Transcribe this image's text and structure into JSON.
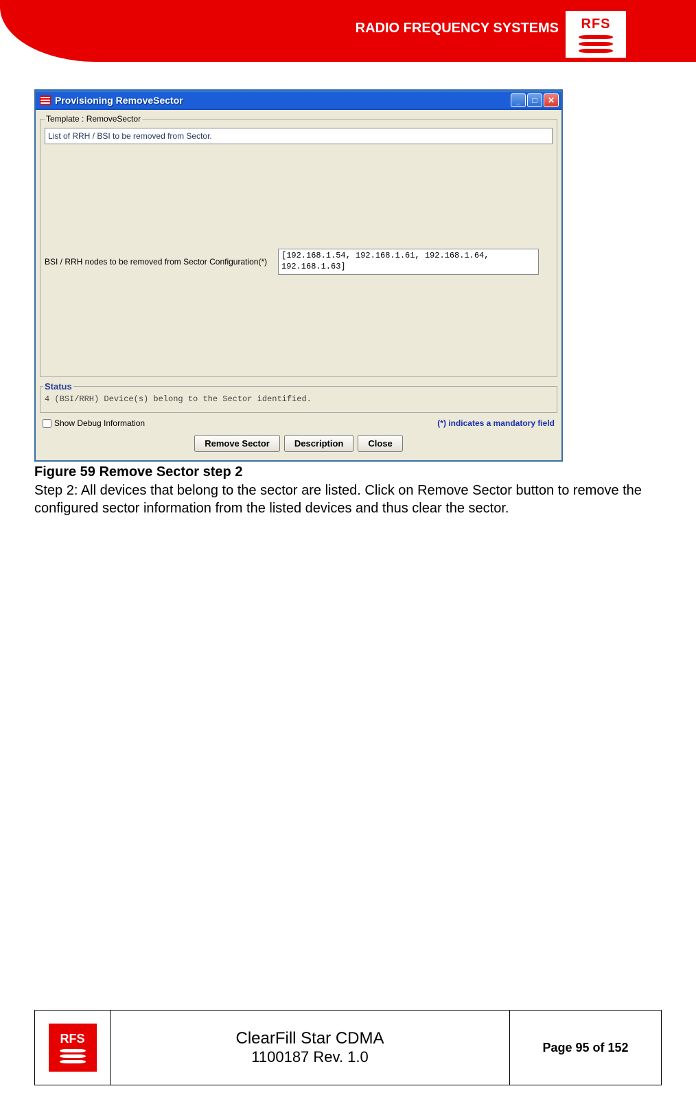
{
  "header": {
    "company": "RADIO FREQUENCY SYSTEMS",
    "logo_text": "RFS"
  },
  "window": {
    "title": "Provisioning RemoveSector",
    "template_legend": "Template : RemoveSector",
    "list_label": "List of RRH / BSI to be removed from Sector.",
    "nodes_label": "BSI / RRH nodes to be removed from Sector Configuration(*)",
    "ip_list": "[192.168.1.54, 192.168.1.61, 192.168.1.64, 192.168.1.63]",
    "status_legend": "Status",
    "status_text": "4 (BSI/RRH) Device(s) belong to the Sector identified.",
    "debug_label": "Show Debug Information",
    "mandatory": "(*) indicates a mandatory field",
    "buttons": {
      "remove": "Remove Sector",
      "description": "Description",
      "close": "Close"
    },
    "controls": {
      "minimize": "_",
      "maximize": "□",
      "close": "✕"
    }
  },
  "figure": {
    "caption": "Figure 59 Remove Sector step 2",
    "step": "Step 2: All devices that belong to the sector are listed. Click on Remove Sector button to remove the configured sector information from the listed devices and thus clear the sector."
  },
  "footer": {
    "logo_text": "RFS",
    "title": "ClearFill Star CDMA",
    "rev": "1100187 Rev. 1.0",
    "page": "Page 95 of 152"
  }
}
